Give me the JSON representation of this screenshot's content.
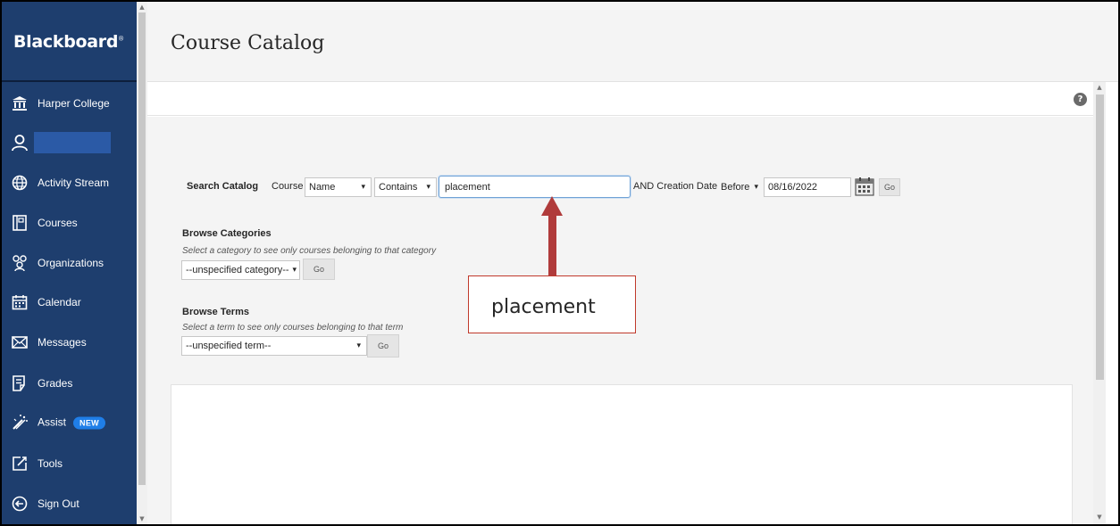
{
  "sidebar": {
    "logo": "Blackboard",
    "items": [
      {
        "label": "Harper College",
        "icon": "institution-icon"
      },
      {
        "label": "",
        "icon": "user-icon"
      },
      {
        "label": "Activity Stream",
        "icon": "globe-icon"
      },
      {
        "label": "Courses",
        "icon": "courses-icon"
      },
      {
        "label": "Organizations",
        "icon": "organizations-icon"
      },
      {
        "label": "Calendar",
        "icon": "calendar-icon"
      },
      {
        "label": "Messages",
        "icon": "envelope-icon"
      },
      {
        "label": "Grades",
        "icon": "grades-icon"
      },
      {
        "label": "Assist",
        "icon": "assist-icon",
        "badge": "NEW"
      },
      {
        "label": "Tools",
        "icon": "tools-icon"
      },
      {
        "label": "Sign Out",
        "icon": "sign-out-icon"
      }
    ]
  },
  "header": {
    "title": "Course Catalog",
    "help": "?"
  },
  "search": {
    "label": "Search Catalog",
    "scope_label": "Course",
    "field_value": "Name",
    "operator_value": "Contains",
    "query_value": "placement",
    "date_label": "AND Creation Date",
    "date_operator_value": "Before",
    "date_value": "08/16/2022",
    "go_label": "Go"
  },
  "browse_categories": {
    "title": "Browse Categories",
    "hint": "Select a category to see only courses belonging to that category",
    "select_value": "--unspecified category--",
    "go_label": "Go"
  },
  "browse_terms": {
    "title": "Browse Terms",
    "hint": "Select a term to see only courses belonging to that term",
    "select_value": "--unspecified term--",
    "go_label": "Go"
  },
  "callout": {
    "text": "placement"
  },
  "colors": {
    "sidebar": "#1e3e6e",
    "accent": "#1f7ee8",
    "callout": "#b03b3b"
  }
}
